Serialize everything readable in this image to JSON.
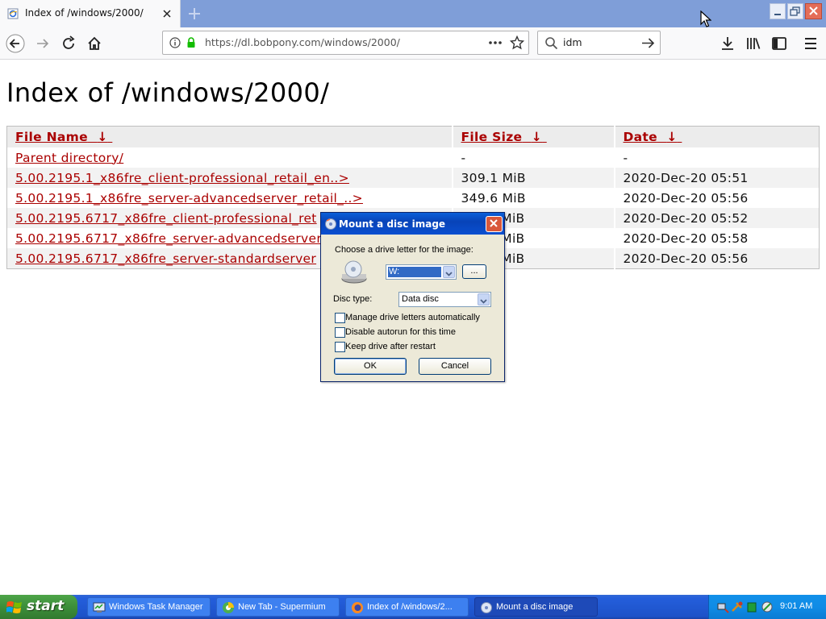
{
  "browser": {
    "tab_title": "Index of /windows/2000/",
    "url": "https://dl.bobpony.com/windows/2000/",
    "search_text": "idm"
  },
  "page": {
    "title": "Index of /windows/2000/",
    "columns": [
      {
        "label": "File Name",
        "sort": "↓"
      },
      {
        "label": "File Size",
        "sort": "↓"
      },
      {
        "label": "Date",
        "sort": "↓"
      }
    ],
    "rows": [
      {
        "name": "Parent directory/",
        "size": "-",
        "date": "-"
      },
      {
        "name": "5.00.2195.1_x86fre_client-professional_retail_en..>",
        "size": "309.1 MiB",
        "date": "2020-Dec-20 05:51"
      },
      {
        "name": "5.00.2195.1_x86fre_server-advancedserver_retail_..>",
        "size": "349.6 MiB",
        "date": "2020-Dec-20 05:56"
      },
      {
        "name": "5.00.2195.6717_x86fre_client-professional_ret",
        "size": "MiB",
        "date": "2020-Dec-20 05:52"
      },
      {
        "name": "5.00.2195.6717_x86fre_server-advancedserver",
        "size": "MiB",
        "date": "2020-Dec-20 05:58"
      },
      {
        "name": "5.00.2195.6717_x86fre_server-standardserver",
        "size": "MiB",
        "date": "2020-Dec-20 05:56"
      }
    ]
  },
  "dialog": {
    "title": "Mount a disc image",
    "drive_prompt": "Choose a drive letter for the image:",
    "drive_value": "W:",
    "browse_label": "...",
    "disc_type_label": "Disc type:",
    "disc_type_value": "Data disc",
    "checkboxes": [
      {
        "label": "Manage drive letters automatically",
        "checked": false
      },
      {
        "label": "Disable autorun for this time",
        "checked": false
      },
      {
        "label": "Keep drive after restart",
        "checked": false
      }
    ],
    "ok_label": "OK",
    "cancel_label": "Cancel"
  },
  "taskbar": {
    "start_label": "start",
    "tasks": [
      {
        "label": "Windows Task Manager",
        "active": false
      },
      {
        "label": "New Tab - Supermium",
        "active": false
      },
      {
        "label": "Index of /windows/2...",
        "active": false
      },
      {
        "label": "Mount a disc image",
        "active": true
      }
    ],
    "clock": "9:01 AM"
  },
  "colors": {
    "link": "#aa0000",
    "xp_blue": "#245edb",
    "start_green": "#3c8e3a",
    "url_lock": "#12bc00"
  }
}
